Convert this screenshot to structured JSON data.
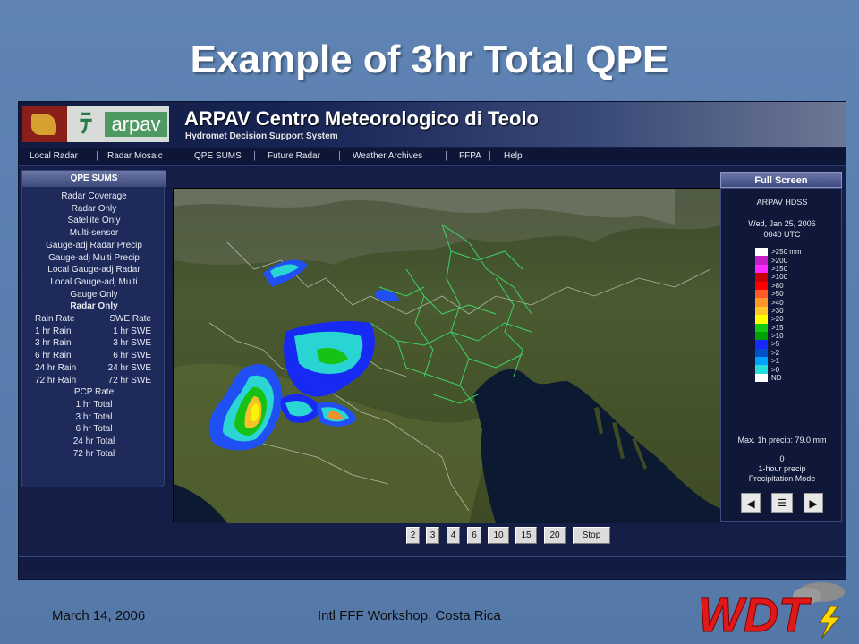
{
  "slide": {
    "title": "Example of 3hr Total QPE",
    "footer_date": "March 14, 2006",
    "footer_center": "Intl FFF Workshop, Costa Rica",
    "logo_label": "WDT"
  },
  "app": {
    "logo_text": "arpav",
    "banner_title": "ARPAV Centro Meteorologico di Teolo",
    "banner_subtitle": "Hydromet Decision Support System",
    "nav": [
      "Local Radar",
      "Radar Mosaic",
      "QPE SUMS",
      "Future Radar",
      "Weather Archives",
      "FFPA",
      "Help"
    ],
    "left_panel": {
      "header": "QPE SUMS",
      "items": [
        "Radar Coverage",
        "Radar Only",
        "Satellite Only",
        "Multi-sensor",
        "Gauge-adj Radar Precip",
        "Gauge-adj Multi Precip",
        "Local Gauge-adj Radar",
        "Local Gauge-adj Multi",
        "Gauge Only"
      ],
      "section": "Radar Only",
      "pairs": [
        [
          "Rain Rate",
          "SWE Rate"
        ],
        [
          "1 hr Rain",
          "1 hr SWE"
        ],
        [
          "3 hr Rain",
          "3 hr SWE"
        ],
        [
          "6 hr Rain",
          "6 hr SWE"
        ],
        [
          "24 hr Rain",
          "24 hr SWE"
        ],
        [
          "72 hr Rain",
          "72 hr SWE"
        ]
      ],
      "totals": [
        "PCP Rate",
        "1 hr Total",
        "3 hr Total",
        "6 hr Total",
        "24 hr Total",
        "72 hr Total"
      ]
    },
    "right_panel": {
      "full_screen": "Full Screen",
      "system": "ARPAV HDSS",
      "date": "Wed, Jan 25, 2006",
      "time": "0040 UTC",
      "legend": [
        {
          "label": ">250 mm",
          "color": "#ffffff"
        },
        {
          "label": ">200",
          "color": "#c81ec8"
        },
        {
          "label": ">150",
          "color": "#ff28ff"
        },
        {
          "label": ">100",
          "color": "#c80000"
        },
        {
          "label": ">80",
          "color": "#ff0000"
        },
        {
          "label": ">50",
          "color": "#ff5a28"
        },
        {
          "label": ">40",
          "color": "#ff9628"
        },
        {
          "label": ">30",
          "color": "#ffc828"
        },
        {
          "label": ">20",
          "color": "#ffff00"
        },
        {
          "label": ">15",
          "color": "#14c814"
        },
        {
          "label": ">10",
          "color": "#00a000"
        },
        {
          "label": ">5",
          "color": "#1428ff"
        },
        {
          "label": ">2",
          "color": "#0050c8"
        },
        {
          "label": ">1",
          "color": "#00a0ff"
        },
        {
          "label": ">0",
          "color": "#28dcdc"
        },
        {
          "label": "ND",
          "color": "#ffffff"
        }
      ],
      "max_precip": "Max. 1h precip: 79.0 mm",
      "zero": "0",
      "mode_1": "1-hour precip",
      "mode_2": "Precipitation Mode",
      "prev_icon": "◀",
      "list_icon": "☰",
      "next_icon": "▶"
    },
    "anim_buttons": [
      "2",
      "3",
      "4",
      "6",
      "10",
      "15",
      "20",
      "Stop"
    ]
  }
}
